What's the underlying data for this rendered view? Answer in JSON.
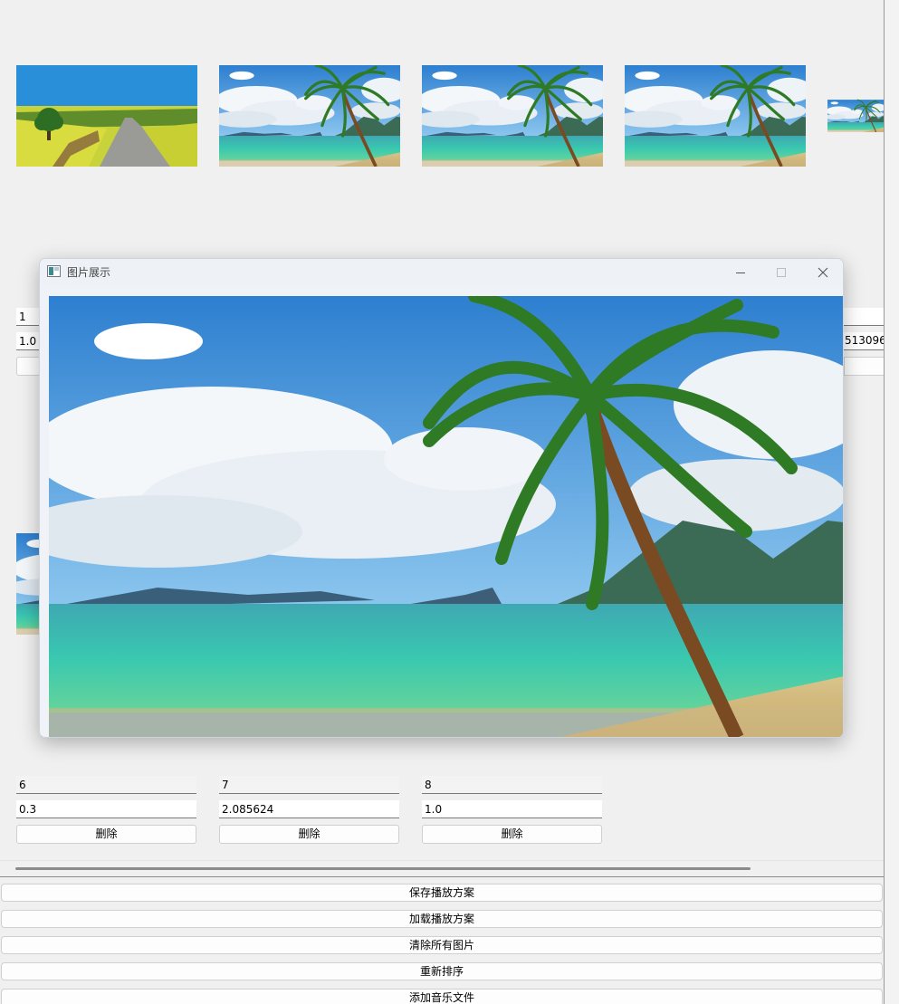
{
  "thumbnails": [
    {
      "image": "countryside-road-tree"
    },
    {
      "image": "tropical-beach-palm"
    },
    {
      "image": "tropical-beach-palm"
    },
    {
      "image": "tropical-beach-palm"
    },
    {
      "image": "tropical-beach-palm"
    }
  ],
  "row1": {
    "index_value": "1",
    "duration_value": "1.0",
    "right_duration_value": "513096"
  },
  "row3": [
    {
      "index": "6",
      "duration": "0.3",
      "delete_label": "删除"
    },
    {
      "index": "7",
      "duration": "2.085624",
      "delete_label": "删除"
    },
    {
      "index": "8",
      "duration": "1.0",
      "delete_label": "删除"
    }
  ],
  "actions": {
    "save_plan": "保存播放方案",
    "load_plan": "加载播放方案",
    "clear_all": "清除所有图片",
    "resort": "重新排序",
    "add_music": "添加音乐文件"
  },
  "popup": {
    "title": "图片展示",
    "image": "tropical-beach-palm"
  },
  "icons": {
    "app": "image-window-icon",
    "minimize": "minimize-icon",
    "maximize": "maximize-icon",
    "close": "close-icon"
  }
}
